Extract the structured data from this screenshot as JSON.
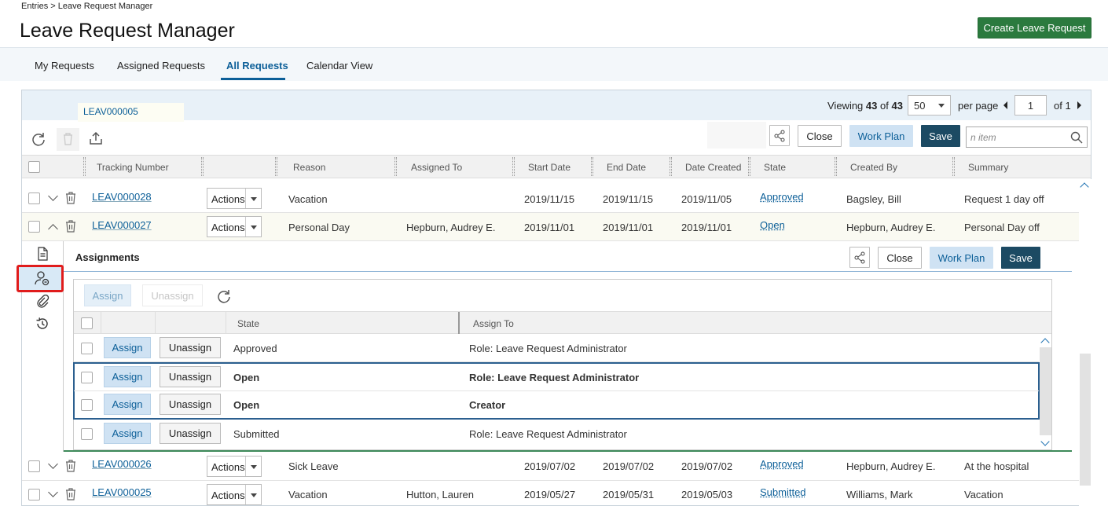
{
  "breadcrumb": "Entries > Leave Request Manager",
  "title": "Leave Request Manager",
  "create_button": "Create Leave Request",
  "tabs": [
    {
      "label": "My Requests"
    },
    {
      "label": "Assigned Requests"
    },
    {
      "label": "All Requests",
      "active": true
    },
    {
      "label": "Calendar View"
    }
  ],
  "open_document_tab": "LEAV000005",
  "paging": {
    "viewing_label": "Viewing",
    "viewing_count": "43",
    "of_label": "of",
    "total": "43",
    "per_page_value": "50",
    "per_page_label": "per page",
    "page": "1",
    "of_pages": "of 1"
  },
  "toolbar": {
    "close": "Close",
    "work_plan": "Work Plan",
    "save": "Save",
    "search_placeholder": "n item"
  },
  "columns": [
    "Tracking Number",
    "",
    "Reason",
    "Assigned To",
    "Start Date",
    "End Date",
    "Date Created",
    "State",
    "Created By",
    "Summary"
  ],
  "rows": [
    {
      "tracking": "LEAV000028",
      "actions": "Actions",
      "reason": "Vacation",
      "assigned_to": "",
      "start": "2019/11/15",
      "end": "2019/11/15",
      "created": "2019/11/05",
      "state": "Approved",
      "created_by": "Bagsley, Bill",
      "summary": "Request 1 day off"
    },
    {
      "tracking": "LEAV000027",
      "actions": "Actions",
      "reason": "Personal Day",
      "assigned_to": "Hepburn, Audrey E.",
      "start": "2019/11/01",
      "end": "2019/11/01",
      "created": "2019/11/01",
      "state": "Open",
      "created_by": "Hepburn, Audrey E.",
      "summary": "Personal Day off"
    },
    {
      "tracking": "LEAV000026",
      "actions": "Actions",
      "reason": "Sick Leave",
      "assigned_to": "",
      "start": "2019/07/02",
      "end": "2019/07/02",
      "created": "2019/07/02",
      "state": "Approved",
      "created_by": "Hepburn, Audrey E.",
      "summary": "At the hospital"
    },
    {
      "tracking": "LEAV000025",
      "actions": "Actions",
      "reason": "Vacation",
      "assigned_to": "Hutton, Lauren",
      "start": "2019/05/27",
      "end": "2019/05/31",
      "created": "2019/05/03",
      "state": "Submitted",
      "created_by": "Williams, Mark",
      "summary": "Vacation"
    }
  ],
  "assignments": {
    "title": "Assignments",
    "close": "Close",
    "work_plan": "Work Plan",
    "save": "Save",
    "assign": "Assign",
    "unassign": "Unassign",
    "columns": [
      "State",
      "Assign To"
    ],
    "rows": [
      {
        "state": "Approved",
        "assign_to": "Role: Leave Request Administrator"
      },
      {
        "state": "Open",
        "assign_to": "Role: Leave Request Administrator"
      },
      {
        "state": "Open",
        "assign_to": "Creator"
      },
      {
        "state": "Submitted",
        "assign_to": "Role: Leave Request Administrator"
      }
    ]
  },
  "colors": {
    "accent": "#0c5f98",
    "create_green": "#2b7a3e",
    "save_dark": "#1c4a63",
    "highlight_red": "#e01c1c"
  }
}
